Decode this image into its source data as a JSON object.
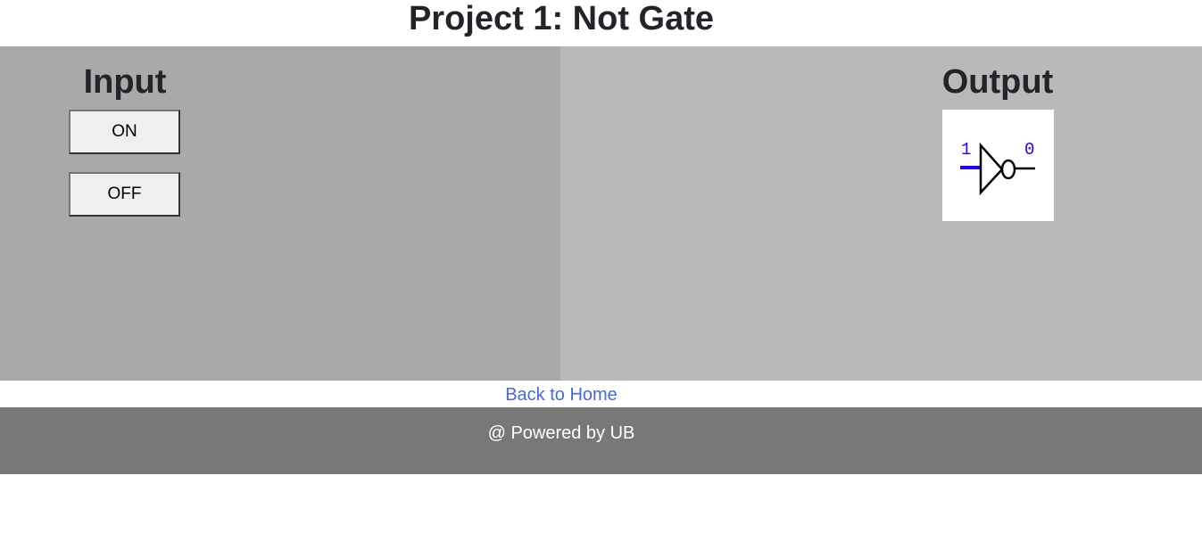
{
  "page": {
    "title": "Project 1: Not Gate"
  },
  "input_panel": {
    "heading": "Input",
    "on_label": "ON",
    "off_label": "OFF",
    "background": "#a9a9a9"
  },
  "output_panel": {
    "heading": "Output",
    "background": "#b9b9b9",
    "gate": {
      "icon": "not-gate-icon",
      "input_value": "1",
      "output_value": "0",
      "input_wire_color": "#2200ff",
      "value_label_color": "#2200ff"
    }
  },
  "nav": {
    "back_link": "Back to Home",
    "link_color": "#4169e1"
  },
  "footer": {
    "text": "@ Powered by UB",
    "background": "#787878"
  }
}
